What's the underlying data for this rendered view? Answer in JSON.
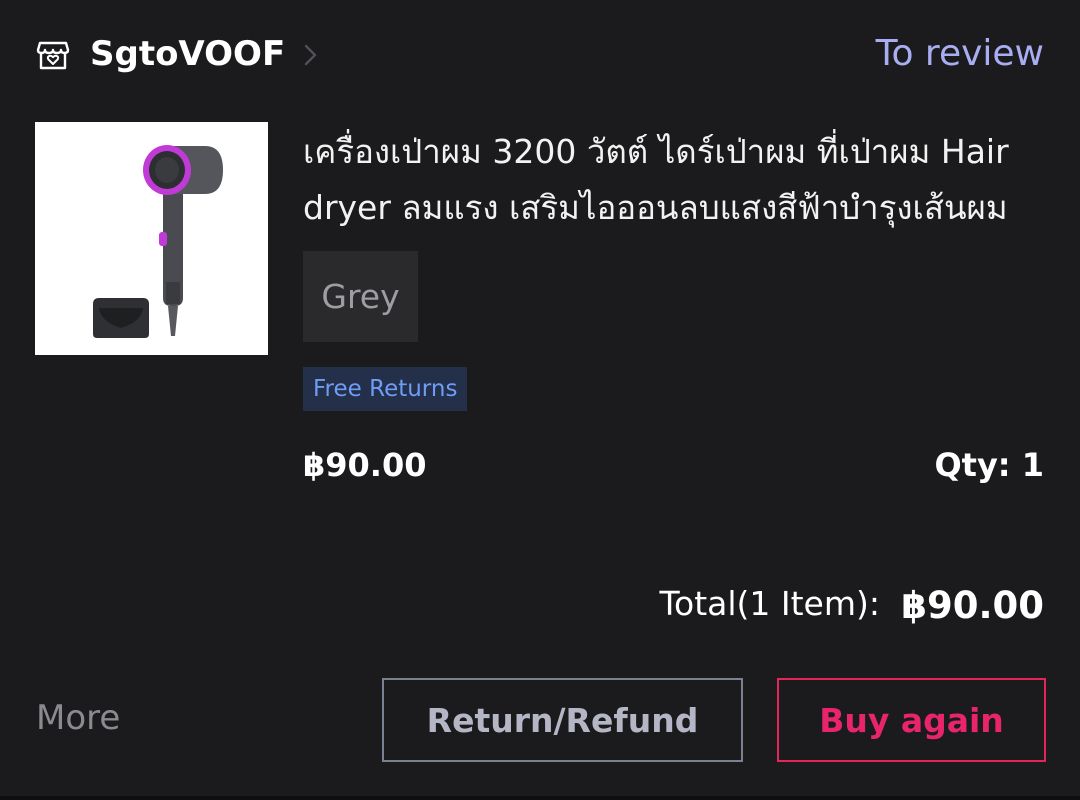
{
  "order": {
    "shop_name": "SgtoVOOF",
    "status": "To review"
  },
  "product": {
    "title": "เครื่องเป่าผม 3200 วัตต์ ไดร์เป่าผม ที่เป่าผม Hair dryer ลมแรง เสริมไอออนลบแสงสีฟ้าบำรุงเส้นผม",
    "image_alt": "hair dryer",
    "variant": "Grey",
    "tag": "Free Returns",
    "price": "฿90.00",
    "qty": "Qty: 1"
  },
  "summary": {
    "total_label": "Total(1 Item):",
    "total_value": "฿90.00"
  },
  "actions": {
    "more": "More",
    "refund": "Return/Refund",
    "buy_again": "Buy again"
  },
  "colors": {
    "background": "#1b1b1d",
    "status": "#a9aef2",
    "tag_text": "#6f9cf5",
    "tag_bg": "#24304a",
    "accent": "#e8246a"
  },
  "icons": {
    "shop": "shop-icon",
    "chevron": "chevron-right-icon"
  }
}
